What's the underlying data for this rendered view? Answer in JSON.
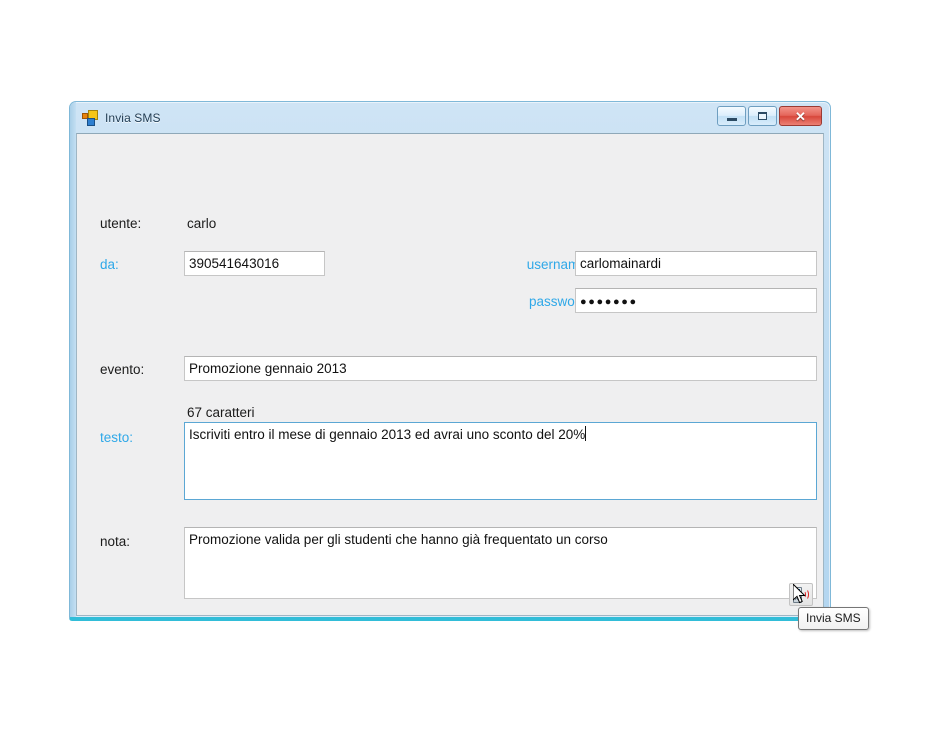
{
  "window": {
    "title": "Invia SMS",
    "icon": "winforms-app-icon",
    "buttons": {
      "minimize": "minimize-button",
      "maximize": "maximize-button",
      "close": "close-button",
      "close_glyph": "✕"
    }
  },
  "form": {
    "utente": {
      "label": "utente:",
      "value": "carlo"
    },
    "da": {
      "label": "da:",
      "value": "390541643016",
      "required": true
    },
    "username_skebby": {
      "label": "username skebby:",
      "value": "carlomainardi",
      "required": true
    },
    "password_skebby": {
      "label": "password skebby:",
      "value": "●●●●●●●",
      "required": true
    },
    "evento": {
      "label": "evento:",
      "value": "Promozione gennaio 2013"
    },
    "char_counter": "67 caratteri",
    "testo": {
      "label": "testo:",
      "value": "Iscriviti entro il mese di gennaio 2013 ed avrai uno sconto del 20%",
      "required": true,
      "focused": true
    },
    "nota": {
      "label": "nota:",
      "value": "Promozione valida per gli studenti che hanno già frequentato un corso"
    }
  },
  "send_button": {
    "name": "invia-sms-button",
    "icon": "sms-phone-icon"
  },
  "tooltip": {
    "text": "Invia SMS"
  },
  "colors": {
    "required_label": "#2fa8e8",
    "window_border": "#7fb8d8",
    "window_bottom_accent": "#32bdd8",
    "client_background": "#efeff0",
    "focus_border": "#5ba7d4"
  }
}
